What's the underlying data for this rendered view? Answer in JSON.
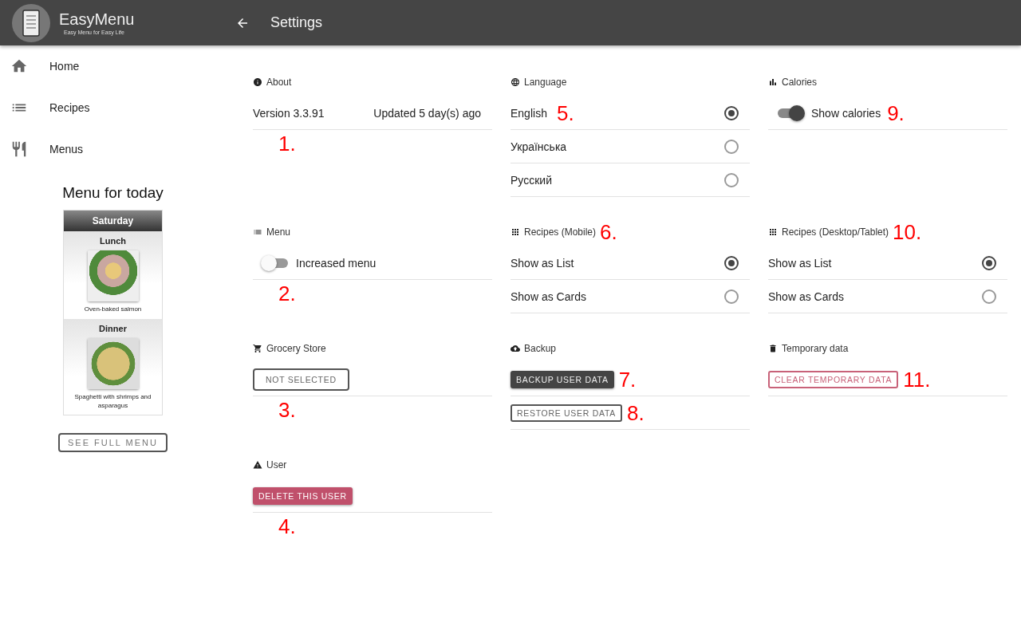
{
  "app": {
    "name": "EasyMenu",
    "tagline": "Easy Menu for Easy Life"
  },
  "header": {
    "title": "Settings"
  },
  "nav": [
    {
      "label": "Home"
    },
    {
      "label": "Recipes"
    },
    {
      "label": "Menus"
    }
  ],
  "today": {
    "heading": "Menu for today",
    "day": "Saturday",
    "meals": [
      {
        "name": "Lunch",
        "dish": "Oven-baked salmon"
      },
      {
        "name": "Dinner",
        "dish": "Spaghetti with shrimps and asparagus"
      }
    ],
    "button": "SEE FULL MENU"
  },
  "sections": [
    {
      "title": "About",
      "rows": [
        {
          "kind": "info",
          "label": "Version 3.3.91",
          "value": "Updated 5 day(s) ago"
        }
      ],
      "footnote": "1."
    },
    {
      "title": "Language",
      "rows": [
        {
          "kind": "radio",
          "label": "English",
          "selected": true,
          "note": "5."
        },
        {
          "kind": "radio",
          "label": "Українська",
          "selected": false
        },
        {
          "kind": "radio",
          "label": "Русский",
          "selected": false
        }
      ]
    },
    {
      "title": "Calories",
      "rows": [
        {
          "kind": "switch",
          "label": "Show calories",
          "on": true,
          "note": "9."
        }
      ]
    },
    {
      "title": "Menu",
      "rows": [
        {
          "kind": "switch",
          "label": "Increased menu",
          "on": false
        }
      ],
      "footnote": "2."
    },
    {
      "title": "Recipes (Mobile)",
      "title_note": "6.",
      "rows": [
        {
          "kind": "radio",
          "label": "Show as List",
          "selected": true
        },
        {
          "kind": "radio",
          "label": "Show as Cards",
          "selected": false
        }
      ]
    },
    {
      "title": "Recipes (Desktop/Tablet)",
      "title_note": "10.",
      "rows": [
        {
          "kind": "radio",
          "label": "Show as List",
          "selected": true
        },
        {
          "kind": "radio",
          "label": "Show as Cards",
          "selected": false
        }
      ]
    },
    {
      "title": "Grocery Store",
      "rows": [
        {
          "kind": "outline",
          "label": "NOT SELECTED"
        }
      ],
      "footnote": "3."
    },
    {
      "title": "Backup",
      "rows": [
        {
          "kind": "solid",
          "label": "BACKUP USER DATA",
          "note": "7."
        },
        {
          "kind": "compact",
          "label": "RESTORE USER DATA",
          "note": "8."
        }
      ]
    },
    {
      "title": "Temporary data",
      "rows": [
        {
          "kind": "warnoutline",
          "label": "CLEAR TEMPORARY DATA",
          "note": "11."
        }
      ]
    },
    {
      "title": "User",
      "rows": [
        {
          "kind": "warnsolid",
          "label": "DELETE THIS USER"
        }
      ],
      "footnote": "4."
    }
  ]
}
